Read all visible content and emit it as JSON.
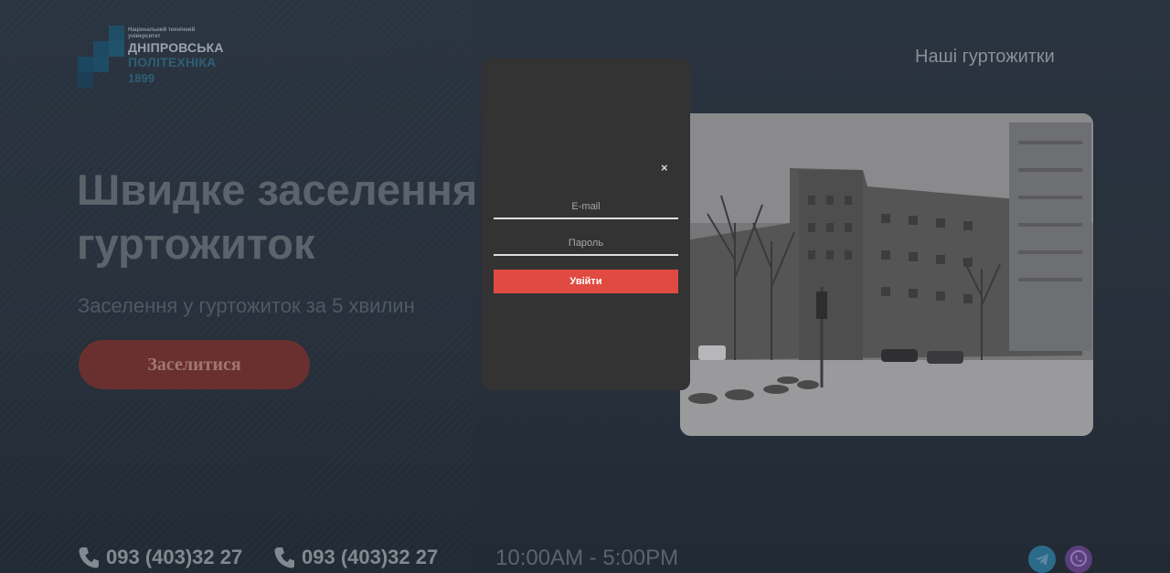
{
  "logo": {
    "line1": "Національний технічний університет",
    "line2": "ДНІПРОВСЬКА",
    "line3": "ПОЛІТЕХНІКА",
    "line4": "1899"
  },
  "nav": {
    "dormitories_link": "Наші гуртожитки"
  },
  "hero": {
    "title_line1": "Швидке заселення",
    "title_line2": "гуртожиток",
    "subtitle": "Заселення у гуртожиток за 5 хвилин",
    "cta_label": "Заселитися"
  },
  "contacts": {
    "phone1": "093 (403)32 27",
    "phone2": "093 (403)32 27",
    "hours": "10:00AM - 5:00PM",
    "socials": [
      "telegram-icon",
      "viber-icon"
    ]
  },
  "modal": {
    "close_label": "×",
    "email_placeholder": "E-mail",
    "password_placeholder": "Пароль",
    "submit_label": "Увійти"
  },
  "colors": {
    "overlay_bg": "#27303b",
    "modal_bg": "#333333",
    "accent_red": "#e04a40",
    "cta_dimmed": "#6a3030",
    "brand_blue": "#2f5e76"
  }
}
